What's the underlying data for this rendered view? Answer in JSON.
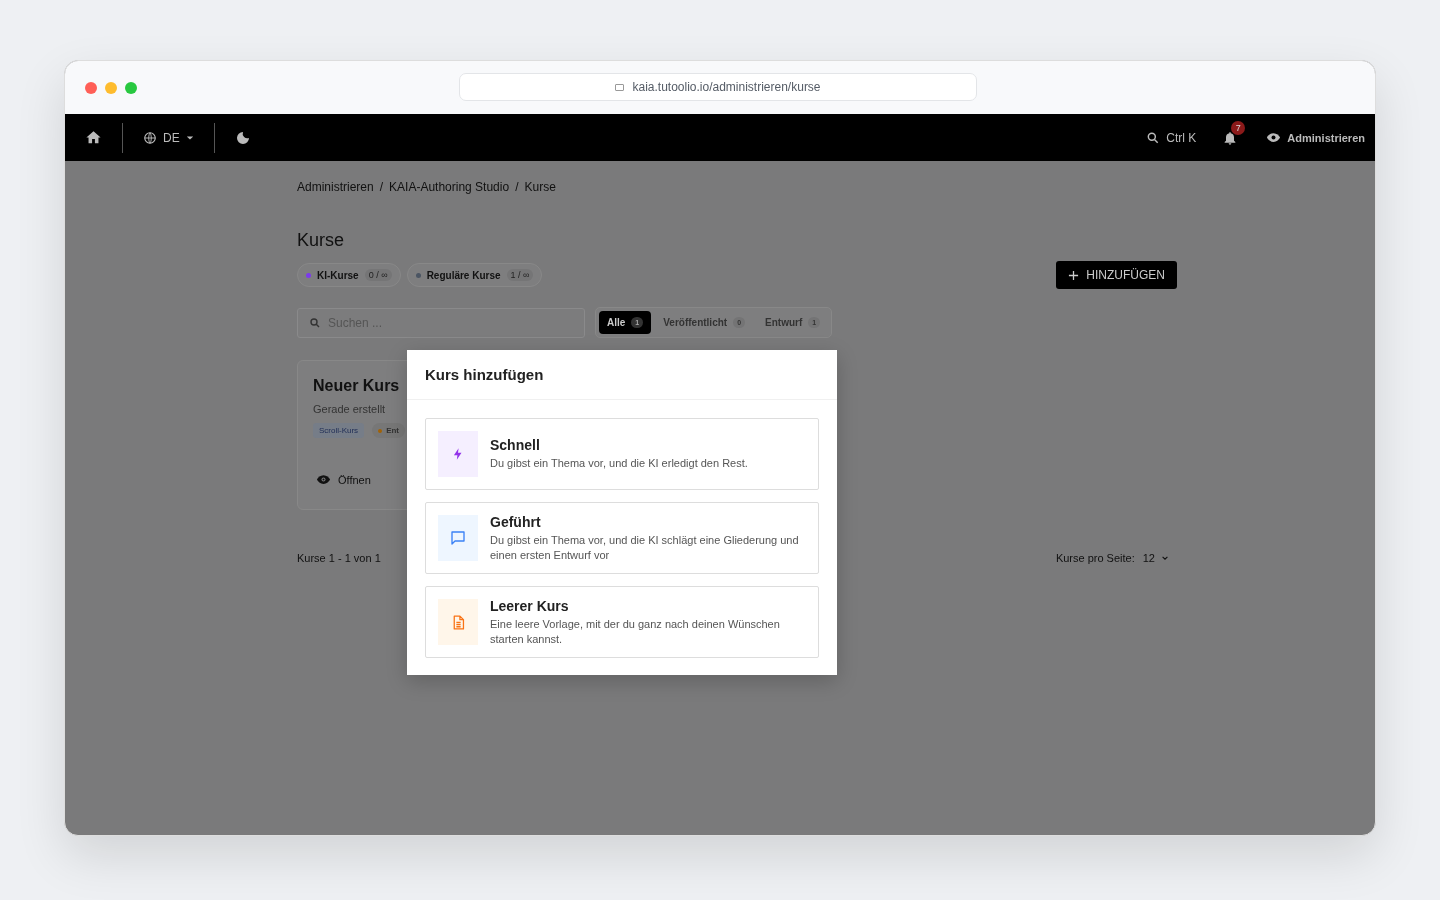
{
  "browser": {
    "url": "kaia.tutoolio.io/administrieren/kurse"
  },
  "topbar": {
    "language": "DE",
    "search_shortcut": "Ctrl K",
    "notification_count": "7",
    "view_label": "Administrieren"
  },
  "breadcrumbs": [
    "Administrieren",
    "KAIA-Authoring Studio",
    "Kurse"
  ],
  "breadcrumb_separator": "/",
  "page_title": "Kurse",
  "quotas": [
    {
      "label": "KI-Kurse",
      "count": "0 / ∞",
      "color": "#7c3aed"
    },
    {
      "label": "Reguläre Kurse",
      "count": "1 / ∞",
      "color": "#4b5563"
    }
  ],
  "add_button": "HINZUFÜGEN",
  "search": {
    "placeholder": "Suchen ..."
  },
  "filters": [
    {
      "label": "Alle",
      "count": "1",
      "selected": true
    },
    {
      "label": "Veröffentlicht",
      "count": "0",
      "selected": false
    },
    {
      "label": "Entwurf",
      "count": "1",
      "selected": false
    }
  ],
  "course_card": {
    "title": "Neuer Kurs",
    "subtitle": "Gerade erstellt",
    "tags": [
      "Scroll-Kurs",
      "Ent"
    ],
    "open_label": "Öffnen"
  },
  "pagination": {
    "range": "Kurse 1 - 1 von 1",
    "per_page_label": "Kurse pro Seite:",
    "per_page": "12"
  },
  "dialog": {
    "title": "Kurs hinzufügen",
    "options": [
      {
        "kind": "bolt",
        "title": "Schnell",
        "description": "Du gibst ein Thema vor, und die KI erledigt den Rest."
      },
      {
        "kind": "chat",
        "title": "Geführt",
        "description": "Du gibst ein Thema vor, und die KI schlägt eine Gliederung und einen ersten Entwurf vor"
      },
      {
        "kind": "document",
        "title": "Leerer Kurs",
        "description": "Eine leere Vorlage, mit der du ganz nach deinen Wünschen starten kannst."
      }
    ]
  }
}
